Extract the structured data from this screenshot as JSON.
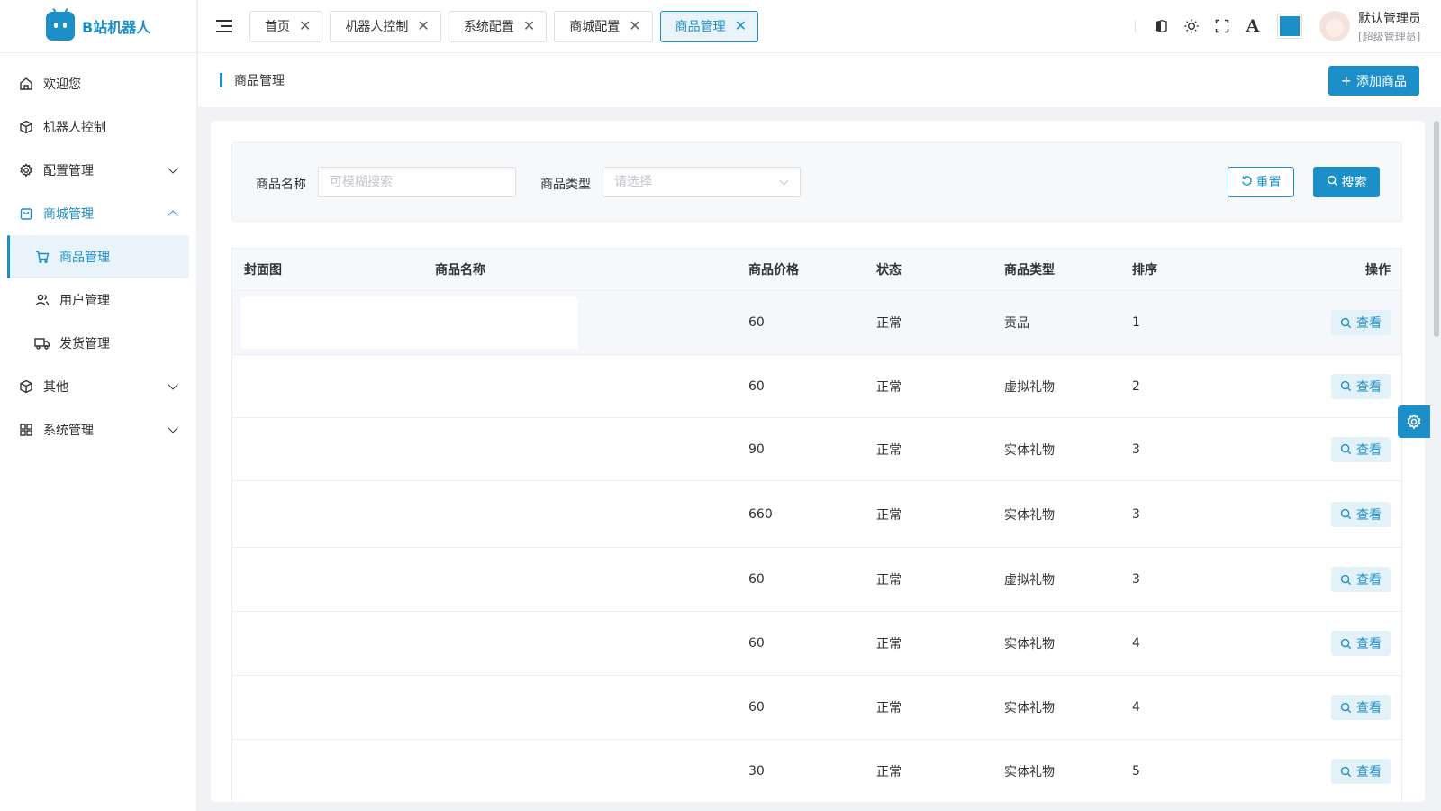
{
  "app": {
    "name": "B站机器人"
  },
  "sidebar": {
    "items": [
      {
        "label": "欢迎您",
        "icon": "home-icon"
      },
      {
        "label": "机器人控制",
        "icon": "cube-icon"
      },
      {
        "label": "配置管理",
        "icon": "gear-icon"
      },
      {
        "label": "商城管理",
        "icon": "shopping-bag-icon"
      },
      {
        "label": "商品管理",
        "icon": "cart-icon"
      },
      {
        "label": "用户管理",
        "icon": "users-icon"
      },
      {
        "label": "发货管理",
        "icon": "truck-icon"
      },
      {
        "label": "其他",
        "icon": "box-icon"
      },
      {
        "label": "系统管理",
        "icon": "grid-icon"
      }
    ]
  },
  "header": {
    "tabs": [
      {
        "label": "首页"
      },
      {
        "label": "机器人控制"
      },
      {
        "label": "系统配置"
      },
      {
        "label": "商城配置"
      },
      {
        "label": "商品管理"
      }
    ],
    "user_name": "默认管理员",
    "user_role": "[超级管理员]",
    "accent_color": "#1c8fc9"
  },
  "page": {
    "title": "商品管理",
    "add_button": "添加商品"
  },
  "search": {
    "name_label": "商品名称",
    "name_placeholder": "可模糊搜索",
    "type_label": "商品类型",
    "type_placeholder": "请选择",
    "reset_label": "重置",
    "search_label": "搜索"
  },
  "table": {
    "columns": [
      "封面图",
      "商品名称",
      "商品价格",
      "状态",
      "商品类型",
      "排序",
      "操作"
    ],
    "action_label": "查看",
    "rows": [
      {
        "price": "60",
        "status": "正常",
        "type": "贡品",
        "sort": "1"
      },
      {
        "price": "60",
        "status": "正常",
        "type": "虚拟礼物",
        "sort": "2"
      },
      {
        "price": "90",
        "status": "正常",
        "type": "实体礼物",
        "sort": "3"
      },
      {
        "price": "660",
        "status": "正常",
        "type": "实体礼物",
        "sort": "3"
      },
      {
        "price": "60",
        "status": "正常",
        "type": "虚拟礼物",
        "sort": "3"
      },
      {
        "price": "60",
        "status": "正常",
        "type": "实体礼物",
        "sort": "4"
      },
      {
        "price": "60",
        "status": "正常",
        "type": "实体礼物",
        "sort": "4"
      },
      {
        "price": "30",
        "status": "正常",
        "type": "实体礼物",
        "sort": "5"
      }
    ]
  }
}
